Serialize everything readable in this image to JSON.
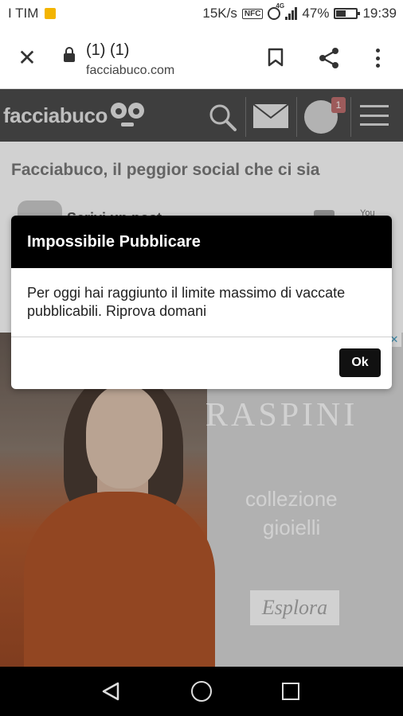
{
  "status_bar": {
    "carrier": "I TIM",
    "speed": "15K/s",
    "nfc": "NFC",
    "network": "4G",
    "battery": "47%",
    "time": "19:39"
  },
  "browser": {
    "tab_title": "(1) (1)",
    "url": "facciabuco.com",
    "close_icon": "close-icon",
    "menu_icon": "more-vert-icon"
  },
  "site": {
    "logo": "facciabuco",
    "notification_count": "1",
    "tagline": "Facciabuco, il peggior social che ci sia",
    "post_author": "Scrivi un post...",
    "post_you": "You"
  },
  "ad": {
    "close": "✕",
    "brand": "RASPINI",
    "line1": "collezione",
    "line2": "gioielli",
    "cta": "Esplora"
  },
  "dialog": {
    "title": "Impossibile Pubblicare",
    "message": "Per oggi hai raggiunto il limite massimo di vaccate pubblicabili. Riprova domani",
    "ok": "Ok"
  }
}
